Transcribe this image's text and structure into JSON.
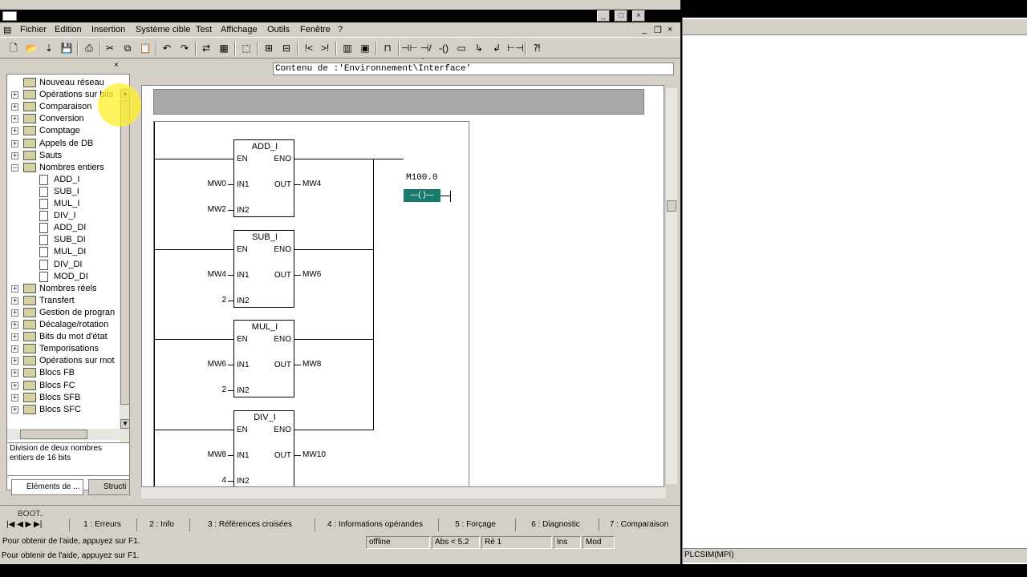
{
  "menu": [
    "Fichier",
    "Edition",
    "Insertion",
    "Système cible",
    "Test",
    "Affichage",
    "Outils",
    "Fenêtre",
    "?"
  ],
  "content_bar": "Contenu de :'Environnement\\Interface'",
  "tree": {
    "items": [
      {
        "label": "Nouveau réseau",
        "expandable": false
      },
      {
        "label": "Opérations sur bits",
        "expandable": true
      },
      {
        "label": "Comparaison",
        "expandable": true
      },
      {
        "label": "Conversion",
        "expandable": true
      },
      {
        "label": "Comptage",
        "expandable": true
      },
      {
        "label": "Appels de DB",
        "expandable": true
      },
      {
        "label": "Sauts",
        "expandable": true
      },
      {
        "label": "Nombres entiers",
        "expandable": true,
        "expanded": true
      },
      {
        "label": "ADD_I",
        "child": true
      },
      {
        "label": "SUB_I",
        "child": true
      },
      {
        "label": "MUL_I",
        "child": true
      },
      {
        "label": "DIV_I",
        "child": true
      },
      {
        "label": "ADD_DI",
        "child": true
      },
      {
        "label": "SUB_DI",
        "child": true
      },
      {
        "label": "MUL_DI",
        "child": true
      },
      {
        "label": "DIV_DI",
        "child": true
      },
      {
        "label": "MOD_DI",
        "child": true
      },
      {
        "label": "Nombres réels",
        "expandable": true
      },
      {
        "label": "Transfert",
        "expandable": true
      },
      {
        "label": "Gestion de progran",
        "expandable": true
      },
      {
        "label": "Décalage/rotation",
        "expandable": true
      },
      {
        "label": "Bits du mot d'état",
        "expandable": true
      },
      {
        "label": "Temporisations",
        "expandable": true
      },
      {
        "label": "Opérations sur mot",
        "expandable": true
      },
      {
        "label": "Blocs FB",
        "expandable": true
      },
      {
        "label": "Blocs FC",
        "expandable": true
      },
      {
        "label": "Blocs SFB",
        "expandable": true
      },
      {
        "label": "Blocs SFC",
        "expandable": true
      }
    ],
    "description": "Division de deux nombres entiers de 16 bits",
    "tab_elements": "Eléments de ...",
    "tab_struct": "Structi"
  },
  "ladder": {
    "coil_label": "M100.0",
    "coil_symbol": "—( )—",
    "blocks": [
      {
        "name": "ADD_I",
        "in1": "MW0",
        "in2": "MW2",
        "out": "MW4"
      },
      {
        "name": "SUB_I",
        "in1": "MW4",
        "in2": "2",
        "out": "MW6"
      },
      {
        "name": "MUL_I",
        "in1": "MW6",
        "in2": "2",
        "out": "MW8"
      },
      {
        "name": "DIV_I",
        "in1": "MW8",
        "in2": "4",
        "out": "MW10"
      }
    ],
    "pins": {
      "en": "EN",
      "eno": "ENO",
      "in1": "IN1",
      "in2": "IN2",
      "out": "OUT"
    }
  },
  "output": {
    "text": "BOOT..",
    "tabs": [
      "1 : Erreurs",
      "2 : Info",
      "3 : Références croisées",
      "4 : Informations opérandes",
      "5 : Forçage",
      "6 : Diagnostic",
      "7 : Comparaison"
    ]
  },
  "status": {
    "help": "Pour obtenir de l'aide, appuyez sur F1.",
    "mode": "offline",
    "abs": "Abs < 5.2",
    "re": "Ré 1",
    "ins": "Ins",
    "mod": "Mod"
  },
  "bottom_help": "Pour obtenir de l'aide, appuyez sur F1.",
  "right_status": "PLCSIM(MPI)",
  "colors": {
    "coil": "#1a7a6e",
    "highlight": "#fff028"
  }
}
